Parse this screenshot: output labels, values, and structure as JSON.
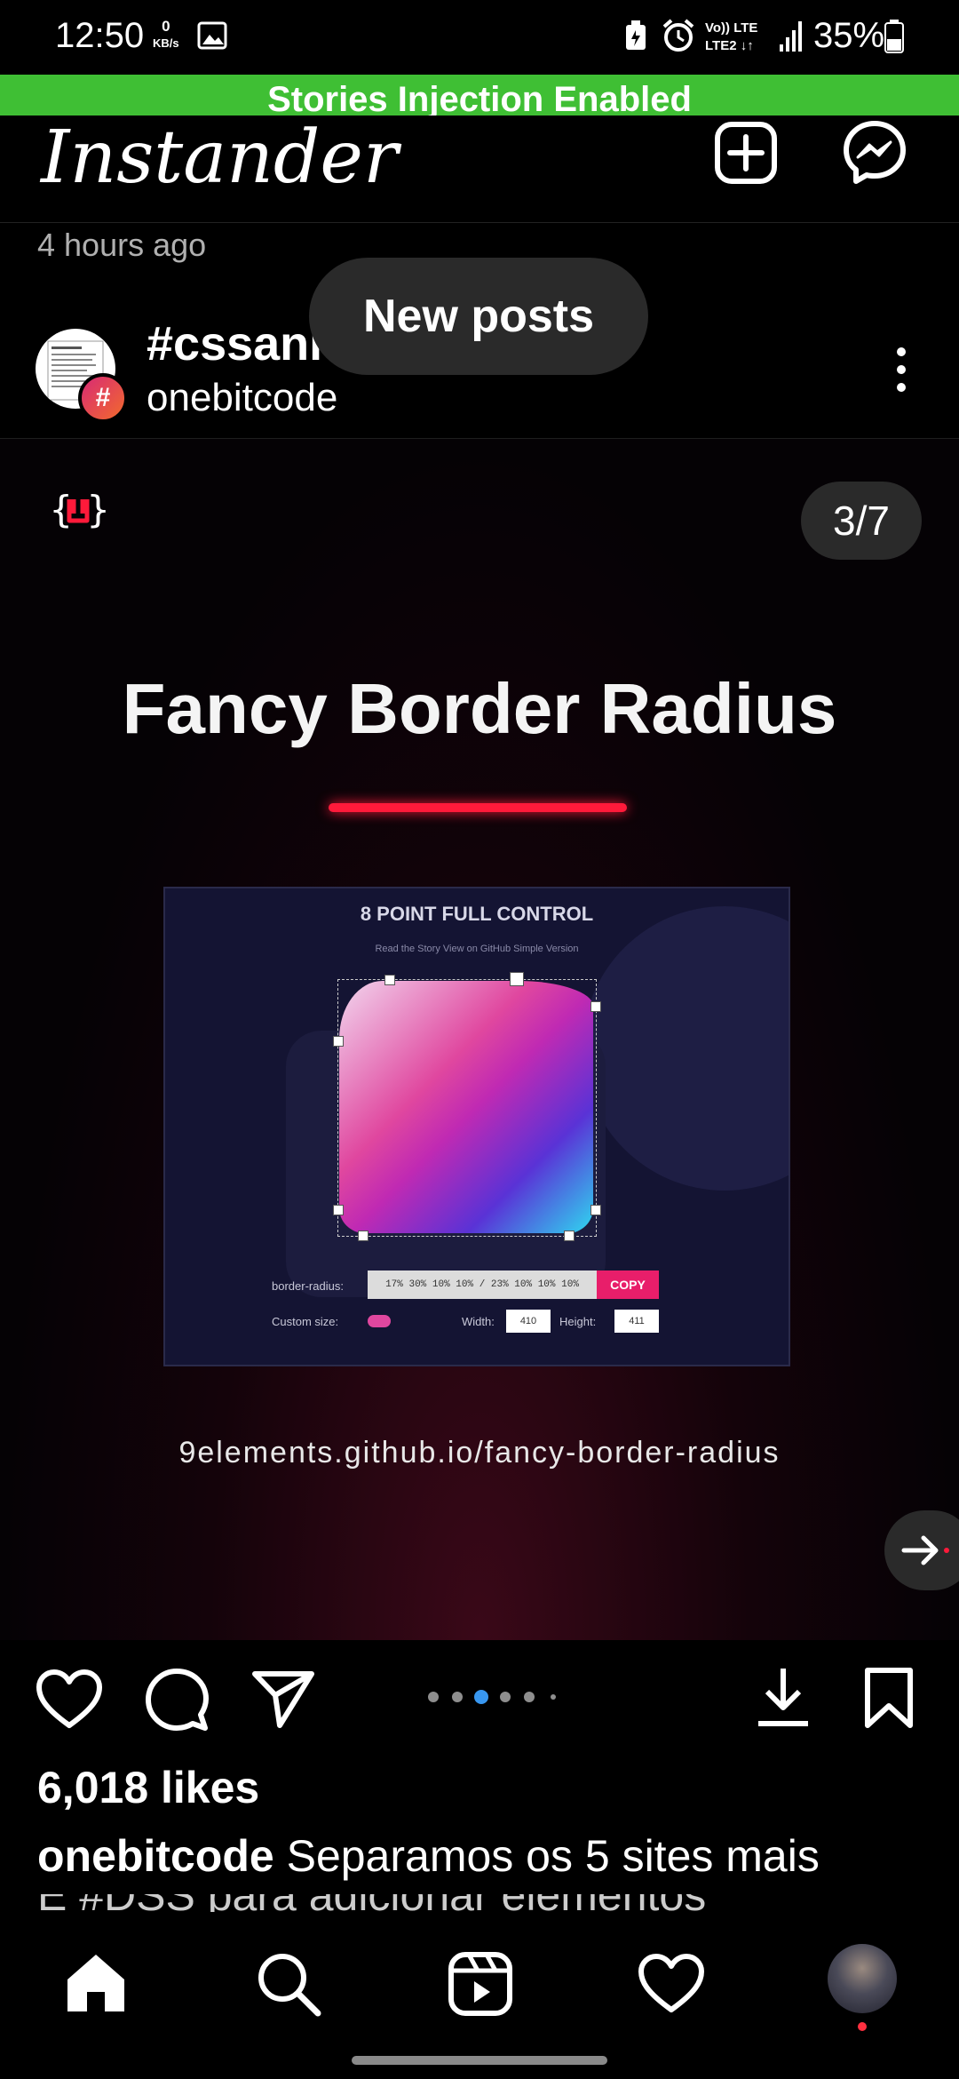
{
  "status_bar": {
    "time": "12:50",
    "data_rate_value": "0",
    "data_rate_unit": "KB/s",
    "battery": "35%"
  },
  "banner": {
    "text": "Stories Injection Enabled"
  },
  "app_bar": {
    "title": "Instander"
  },
  "post": {
    "time_ago": "4 hours ago",
    "title": "#cssani",
    "subtitle": "onebitcode",
    "toast": "New posts",
    "slide_counter": "3/7",
    "slide": {
      "title": "Fancy Border Radius",
      "demo_heading": "8 POINT FULL CONTROL",
      "demo_links": "Read the Story    View on GitHub    Simple Version",
      "border_radius_label": "border-radius:",
      "border_radius_value": "17% 30% 10% 10% / 23% 10% 10% 10%",
      "copy_label": "COPY",
      "custom_size_label": "Custom size:",
      "width_label": "Width:",
      "width_value": "410",
      "height_label": "Height:",
      "height_value": "411",
      "url": "9elements.github.io/fancy-border-radius"
    },
    "carousel": {
      "count": 6,
      "active_index": 2
    },
    "likes": "6,018 likes",
    "caption_user": "onebitcode",
    "caption_text": "Separamos os 5 sites mais",
    "caption_cut": "E #DSS para adicionar elementos"
  },
  "icons": {
    "new_post": "plus-square-icon",
    "messenger": "messenger-icon",
    "more": "more-vertical-icon",
    "like": "heart-icon",
    "comment": "comment-icon",
    "share": "send-icon",
    "download": "download-icon",
    "save": "bookmark-icon",
    "home": "home-icon",
    "search": "search-icon",
    "reels": "reels-icon",
    "activity": "heart-icon",
    "profile": "avatar"
  },
  "colors": {
    "banner": "#3fbf34",
    "carousel_active": "#3897f0",
    "accent_pink": "#e81e6a",
    "notification_dot": "#ff3040"
  }
}
